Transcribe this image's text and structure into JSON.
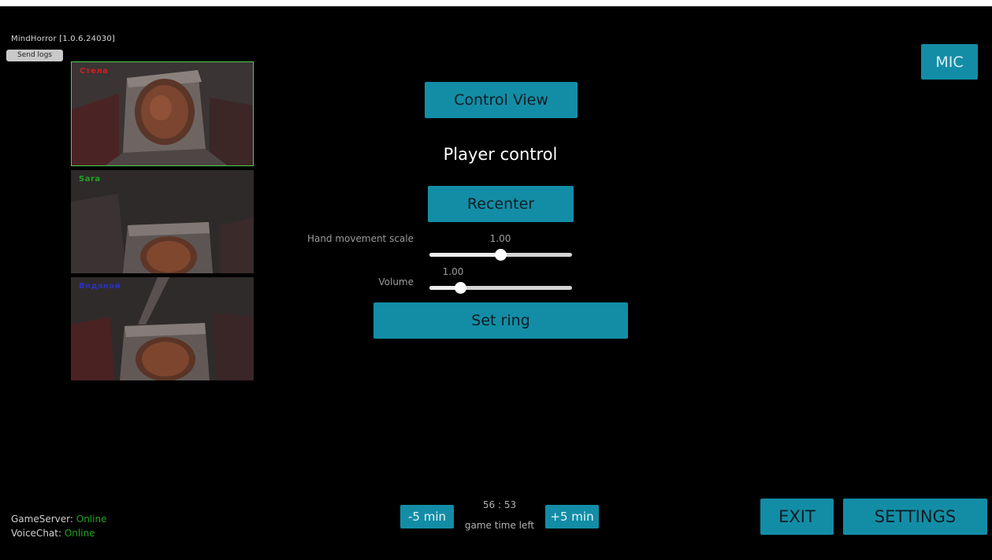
{
  "app": {
    "title": "MindHorror [1.0.6.24030]",
    "send_logs": "Send logs"
  },
  "feeds": [
    {
      "label": "Стела",
      "label_color": "#cc2020",
      "selected": true
    },
    {
      "label": "Sara",
      "label_color": "#1ea51e",
      "selected": false
    },
    {
      "label": "Водяной",
      "label_color": "#2830c0",
      "selected": false
    }
  ],
  "controls": {
    "control_view": "Control View",
    "heading": "Player control",
    "recenter": "Recenter",
    "hand_movement_label": "Hand movement scale",
    "hand_movement_value": "1.00",
    "hand_movement_fraction": 0.5,
    "volume_label": "Volume",
    "volume_value": "1.00",
    "volume_fraction": 0.22,
    "set_ring": "Set ring"
  },
  "mic": "MIC",
  "timer": {
    "minus": "-5 min",
    "plus": "+5 min",
    "time": "56 : 53",
    "caption": "game time left"
  },
  "footer": {
    "exit": "EXIT",
    "settings": "SETTINGS"
  },
  "status": {
    "game_server_label": "GameServer:",
    "game_server_value": "Online",
    "voice_chat_label": "VoiceChat:",
    "voice_chat_value": "Online"
  },
  "colors": {
    "accent": "#138da6",
    "online": "#1ea51e",
    "selected_border": "#4ccf4c"
  }
}
